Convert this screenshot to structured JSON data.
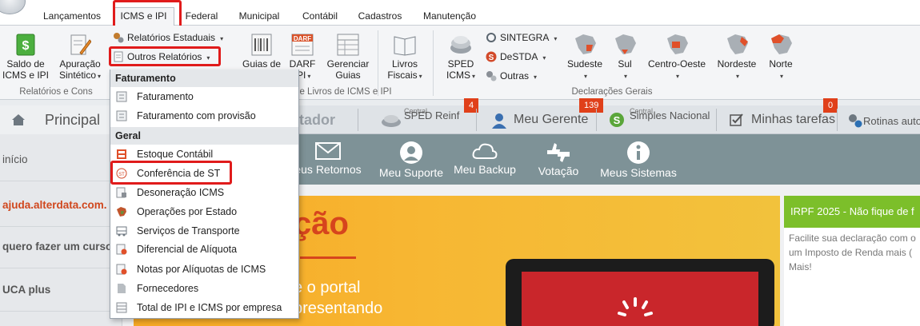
{
  "tabs": [
    "Lançamentos",
    "ICMS e IPI",
    "Federal",
    "Municipal",
    "Contábil",
    "Cadastros",
    "Manutenção"
  ],
  "ribbon": {
    "saldo": [
      "Saldo de",
      "ICMS e IPI"
    ],
    "apuracao": [
      "Apuração",
      "Sintético"
    ],
    "relatorios_estaduais": "Relatórios Estaduais",
    "outros_relatorios": "Outros Relatórios",
    "guias": [
      "Guias de",
      ""
    ],
    "darf": [
      "DARF",
      "IPI"
    ],
    "darf_icon_text": "DARF",
    "gerenciar": [
      "Gerenciar",
      "Guias"
    ],
    "livros": [
      "Livros",
      "Fiscais"
    ],
    "sped": [
      "SPED",
      "ICMS"
    ],
    "sintegra": "SINTEGRA",
    "destda": "DeSTDA",
    "outras": "Outras",
    "regions": [
      "Sudeste",
      "Sul",
      "Centro-Oeste",
      "Nordeste",
      "Norte"
    ],
    "group_relatorios": "Relatórios e Cons",
    "group_livros": "e Livros de ICMS e IPI",
    "group_declaracoes": "Declarações Gerais"
  },
  "bar2": {
    "principal": "Principal",
    "contador": "tador",
    "sped_reinf_small": "Central",
    "sped_reinf": "SPED Reinf",
    "sped_badge": "4",
    "meu_gerente": "Meu Gerente",
    "gerente_badge": "139",
    "simples_small": "Central",
    "simples": "Simples Nacional",
    "tarefas": "Minhas tarefas",
    "tarefas_badge": "0",
    "rotinas": "Rotinas autom"
  },
  "sidebar": [
    "início",
    "ajuda.alterdata.com.",
    "quero fazer um curso",
    "UCA plus"
  ],
  "nav": [
    "eus Retornos",
    "Meu Suporte",
    "Meu Backup",
    "Votação",
    "Meus Sistemas"
  ],
  "banner": {
    "title": "ção",
    "text": [
      "e o portal",
      "presentando"
    ]
  },
  "right_card": {
    "head": "IRPF 2025 - Não fique de f",
    "body": [
      "Facilite sua declaração com o",
      "um Imposto de Renda mais (",
      "Mais!"
    ]
  },
  "menu": {
    "faturamento_head": "Faturamento",
    "faturamento": [
      "Faturamento",
      "Faturamento com provisão"
    ],
    "geral_head": "Geral",
    "geral": [
      "Estoque Contábil",
      "Conferência de ST",
      "Desoneração ICMS",
      "Operações por Estado",
      "Serviços de Transporte",
      "Diferencial de Alíquota",
      "Notas por Alíquotas de ICMS",
      "Fornecedores",
      "Total de IPI e ICMS por empresa"
    ],
    "st_icon_text": "ST"
  },
  "colors": {
    "highlight": "#e01b1b",
    "badge": "#e0401a",
    "nav_strip": "#7e9297",
    "banner": "#f6a824",
    "accent_orange": "#d6451d",
    "card_green": "#7cbf2a"
  }
}
